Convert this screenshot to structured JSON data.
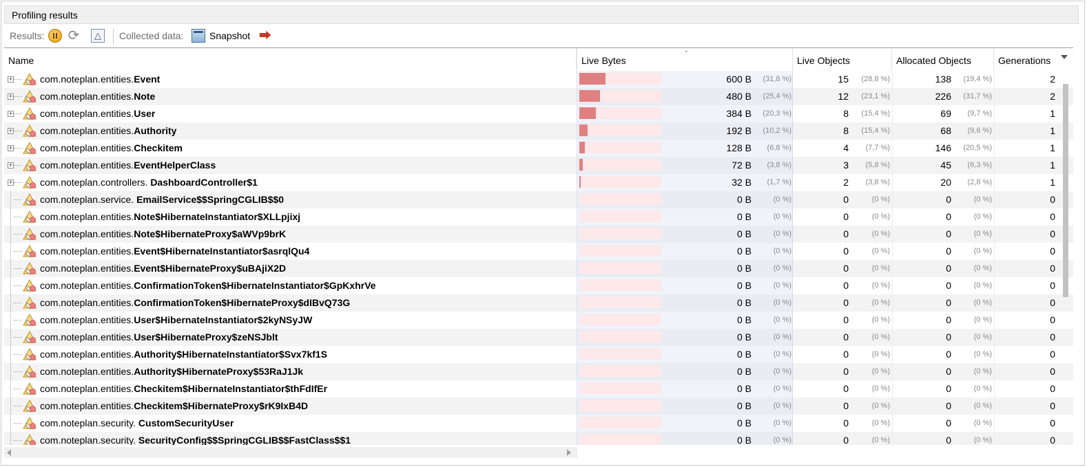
{
  "panel": {
    "title": "Profiling results"
  },
  "toolbar": {
    "results_label": "Results:",
    "collected_label": "Collected data:",
    "snapshot_label": "Snapshot",
    "icons": [
      "pause-icon",
      "refresh-icon",
      "delta-icon",
      "snapshot-icon",
      "export-icon"
    ]
  },
  "columns": {
    "name": "Name",
    "live_bytes": "Live Bytes",
    "live_objects": "Live Objects",
    "allocated_objects": "Allocated Objects",
    "generations": "Generations"
  },
  "colors": {
    "bar_fill": "#e08080",
    "bar_bg": "#fde8ea"
  },
  "rows": [
    {
      "pkg": "com.noteplan.entities.",
      "cls": "Event",
      "expandable": true,
      "bytes": "600 B",
      "bytes_pct": "(31,8 %)",
      "bar": 0.318,
      "live": "15",
      "live_pct": "(28,8 %)",
      "alloc": "138",
      "alloc_pct": "(19,4 %)",
      "gen": "2"
    },
    {
      "pkg": "com.noteplan.entities.",
      "cls": "Note",
      "expandable": true,
      "bytes": "480 B",
      "bytes_pct": "(25,4 %)",
      "bar": 0.254,
      "live": "12",
      "live_pct": "(23,1 %)",
      "alloc": "226",
      "alloc_pct": "(31,7 %)",
      "gen": "2"
    },
    {
      "pkg": "com.noteplan.entities.",
      "cls": "User",
      "expandable": true,
      "bytes": "384 B",
      "bytes_pct": "(20,3 %)",
      "bar": 0.203,
      "live": "8",
      "live_pct": "(15,4 %)",
      "alloc": "69",
      "alloc_pct": "(9,7 %)",
      "gen": "1"
    },
    {
      "pkg": "com.noteplan.entities.",
      "cls": "Authority",
      "expandable": true,
      "bytes": "192 B",
      "bytes_pct": "(10,2 %)",
      "bar": 0.102,
      "live": "8",
      "live_pct": "(15,4 %)",
      "alloc": "68",
      "alloc_pct": "(9,6 %)",
      "gen": "1"
    },
    {
      "pkg": "com.noteplan.entities.",
      "cls": "Checkitem",
      "expandable": true,
      "bytes": "128 B",
      "bytes_pct": "(6,8 %)",
      "bar": 0.068,
      "live": "4",
      "live_pct": "(7,7 %)",
      "alloc": "146",
      "alloc_pct": "(20,5 %)",
      "gen": "1"
    },
    {
      "pkg": "com.noteplan.entities.",
      "cls": "EventHelperClass",
      "expandable": true,
      "bytes": "72 B",
      "bytes_pct": "(3,8 %)",
      "bar": 0.038,
      "live": "3",
      "live_pct": "(5,8 %)",
      "alloc": "45",
      "alloc_pct": "(6,3 %)",
      "gen": "1"
    },
    {
      "pkg": "com.noteplan.controllers. ",
      "cls": "DashboardController$1",
      "expandable": true,
      "bytes": "32 B",
      "bytes_pct": "(1,7 %)",
      "bar": 0.017,
      "live": "2",
      "live_pct": "(3,8 %)",
      "alloc": "20",
      "alloc_pct": "(2,8 %)",
      "gen": "1"
    },
    {
      "pkg": "com.noteplan.service. ",
      "cls": "EmailService$$SpringCGLIB$$0",
      "expandable": false,
      "bytes": "0 B",
      "bytes_pct": "(0 %)",
      "bar": 0,
      "live": "0",
      "live_pct": "(0 %)",
      "alloc": "0",
      "alloc_pct": "(0 %)",
      "gen": "0"
    },
    {
      "pkg": "com.noteplan.entities.",
      "cls": "Note$HibernateInstantiator$XLLpjixj",
      "expandable": false,
      "bytes": "0 B",
      "bytes_pct": "(0 %)",
      "bar": 0,
      "live": "0",
      "live_pct": "(0 %)",
      "alloc": "0",
      "alloc_pct": "(0 %)",
      "gen": "0"
    },
    {
      "pkg": "com.noteplan.entities.",
      "cls": "Note$HibernateProxy$aWVp9brK",
      "expandable": false,
      "bytes": "0 B",
      "bytes_pct": "(0 %)",
      "bar": 0,
      "live": "0",
      "live_pct": "(0 %)",
      "alloc": "0",
      "alloc_pct": "(0 %)",
      "gen": "0"
    },
    {
      "pkg": "com.noteplan.entities.",
      "cls": "Event$HibernateInstantiator$asrqlQu4",
      "expandable": false,
      "bytes": "0 B",
      "bytes_pct": "(0 %)",
      "bar": 0,
      "live": "0",
      "live_pct": "(0 %)",
      "alloc": "0",
      "alloc_pct": "(0 %)",
      "gen": "0"
    },
    {
      "pkg": "com.noteplan.entities.",
      "cls": "Event$HibernateProxy$uBAjiX2D",
      "expandable": false,
      "bytes": "0 B",
      "bytes_pct": "(0 %)",
      "bar": 0,
      "live": "0",
      "live_pct": "(0 %)",
      "alloc": "0",
      "alloc_pct": "(0 %)",
      "gen": "0"
    },
    {
      "pkg": "com.noteplan.entities.",
      "cls": "ConfirmationToken$HibernateInstantiator$GpKxhrVe",
      "expandable": false,
      "bytes": "0 B",
      "bytes_pct": "(0 %)",
      "bar": 0,
      "live": "0",
      "live_pct": "(0 %)",
      "alloc": "0",
      "alloc_pct": "(0 %)",
      "gen": "0"
    },
    {
      "pkg": "com.noteplan.entities.",
      "cls": "ConfirmationToken$HibernateProxy$dIBvQ73G",
      "expandable": false,
      "bytes": "0 B",
      "bytes_pct": "(0 %)",
      "bar": 0,
      "live": "0",
      "live_pct": "(0 %)",
      "alloc": "0",
      "alloc_pct": "(0 %)",
      "gen": "0"
    },
    {
      "pkg": "com.noteplan.entities.",
      "cls": "User$HibernateInstantiator$2kyNSyJW",
      "expandable": false,
      "bytes": "0 B",
      "bytes_pct": "(0 %)",
      "bar": 0,
      "live": "0",
      "live_pct": "(0 %)",
      "alloc": "0",
      "alloc_pct": "(0 %)",
      "gen": "0"
    },
    {
      "pkg": "com.noteplan.entities.",
      "cls": "User$HibernateProxy$zeNSJblt",
      "expandable": false,
      "bytes": "0 B",
      "bytes_pct": "(0 %)",
      "bar": 0,
      "live": "0",
      "live_pct": "(0 %)",
      "alloc": "0",
      "alloc_pct": "(0 %)",
      "gen": "0"
    },
    {
      "pkg": "com.noteplan.entities.",
      "cls": "Authority$HibernateInstantiator$Svx7kf1S",
      "expandable": false,
      "bytes": "0 B",
      "bytes_pct": "(0 %)",
      "bar": 0,
      "live": "0",
      "live_pct": "(0 %)",
      "alloc": "0",
      "alloc_pct": "(0 %)",
      "gen": "0"
    },
    {
      "pkg": "com.noteplan.entities.",
      "cls": "Authority$HibernateProxy$53RaJ1Jk",
      "expandable": false,
      "bytes": "0 B",
      "bytes_pct": "(0 %)",
      "bar": 0,
      "live": "0",
      "live_pct": "(0 %)",
      "alloc": "0",
      "alloc_pct": "(0 %)",
      "gen": "0"
    },
    {
      "pkg": "com.noteplan.entities.",
      "cls": "Checkitem$HibernateInstantiator$thFdIfEr",
      "expandable": false,
      "bytes": "0 B",
      "bytes_pct": "(0 %)",
      "bar": 0,
      "live": "0",
      "live_pct": "(0 %)",
      "alloc": "0",
      "alloc_pct": "(0 %)",
      "gen": "0"
    },
    {
      "pkg": "com.noteplan.entities.",
      "cls": "Checkitem$HibernateProxy$rK9IxB4D",
      "expandable": false,
      "bytes": "0 B",
      "bytes_pct": "(0 %)",
      "bar": 0,
      "live": "0",
      "live_pct": "(0 %)",
      "alloc": "0",
      "alloc_pct": "(0 %)",
      "gen": "0"
    },
    {
      "pkg": "com.noteplan.security. ",
      "cls": "CustomSecurityUser",
      "expandable": false,
      "bytes": "0 B",
      "bytes_pct": "(0 %)",
      "bar": 0,
      "live": "0",
      "live_pct": "(0 %)",
      "alloc": "0",
      "alloc_pct": "(0 %)",
      "gen": "0"
    },
    {
      "pkg": "com.noteplan.security. ",
      "cls": "SecurityConfig$$SpringCGLIB$$FastClass$$1",
      "expandable": false,
      "bytes": "0 B",
      "bytes_pct": "(0 %)",
      "bar": 0,
      "live": "0",
      "live_pct": "(0 %)",
      "alloc": "0",
      "alloc_pct": "(0 %)",
      "gen": "0"
    }
  ]
}
